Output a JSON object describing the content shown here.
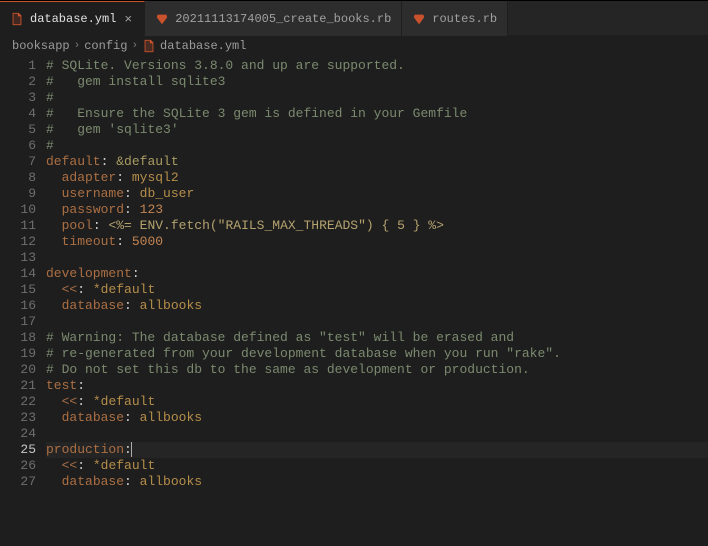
{
  "tabs": [
    {
      "label": "database.yml",
      "icon": "yaml-file-icon",
      "active": true,
      "closable": true
    },
    {
      "label": "20211113174005_create_books.rb",
      "icon": "ruby-file-icon",
      "active": false,
      "closable": false
    },
    {
      "label": "routes.rb",
      "icon": "ruby-file-icon",
      "active": false,
      "closable": false
    }
  ],
  "breadcrumbs": {
    "parts": [
      "booksapp",
      "config"
    ],
    "file": "database.yml"
  },
  "lines": [
    {
      "n": 1,
      "t": "comment",
      "text": "# SQLite. Versions 3.8.0 and up are supported."
    },
    {
      "n": 2,
      "t": "comment",
      "text": "#   gem install sqlite3"
    },
    {
      "n": 3,
      "t": "comment",
      "text": "#"
    },
    {
      "n": 4,
      "t": "comment",
      "text": "#   Ensure the SQLite 3 gem is defined in your Gemfile"
    },
    {
      "n": 5,
      "t": "comment",
      "text": "#   gem 'sqlite3'"
    },
    {
      "n": 6,
      "t": "comment",
      "text": "#"
    },
    {
      "n": 7,
      "t": "kv",
      "indent": 0,
      "key": "default",
      "after": "anchor",
      "val": "&default"
    },
    {
      "n": 8,
      "t": "kv",
      "indent": 1,
      "key": "adapter",
      "after": "str",
      "val": "mysql2"
    },
    {
      "n": 9,
      "t": "kv",
      "indent": 1,
      "key": "username",
      "after": "str",
      "val": "db_user"
    },
    {
      "n": 10,
      "t": "kv",
      "indent": 1,
      "key": "password",
      "after": "num",
      "val": "123"
    },
    {
      "n": 11,
      "t": "kv",
      "indent": 1,
      "key": "pool",
      "after": "erb",
      "val": "<%= ENV.fetch(\"RAILS_MAX_THREADS\") { 5 } %>"
    },
    {
      "n": 12,
      "t": "kv",
      "indent": 1,
      "key": "timeout",
      "after": "num",
      "val": "5000"
    },
    {
      "n": 13,
      "t": "blank"
    },
    {
      "n": 14,
      "t": "kv",
      "indent": 0,
      "key": "development",
      "after": "none"
    },
    {
      "n": 15,
      "t": "kv",
      "indent": 1,
      "key": "<<",
      "after": "alias",
      "val": "*default"
    },
    {
      "n": 16,
      "t": "kv",
      "indent": 1,
      "key": "database",
      "after": "str",
      "val": "allbooks"
    },
    {
      "n": 17,
      "t": "blank"
    },
    {
      "n": 18,
      "t": "comment",
      "text": "# Warning: The database defined as \"test\" will be erased and"
    },
    {
      "n": 19,
      "t": "comment",
      "text": "# re-generated from your development database when you run \"rake\"."
    },
    {
      "n": 20,
      "t": "comment",
      "text": "# Do not set this db to the same as development or production."
    },
    {
      "n": 21,
      "t": "kv",
      "indent": 0,
      "key": "test",
      "after": "none"
    },
    {
      "n": 22,
      "t": "kv",
      "indent": 1,
      "key": "<<",
      "after": "alias",
      "val": "*default"
    },
    {
      "n": 23,
      "t": "kv",
      "indent": 1,
      "key": "database",
      "after": "str",
      "val": "allbooks"
    },
    {
      "n": 24,
      "t": "blank"
    },
    {
      "n": 25,
      "t": "kv",
      "indent": 0,
      "key": "production",
      "after": "none",
      "current": true
    },
    {
      "n": 26,
      "t": "kv",
      "indent": 1,
      "key": "<<",
      "after": "alias",
      "val": "*default"
    },
    {
      "n": 27,
      "t": "kv",
      "indent": 1,
      "key": "database",
      "after": "str",
      "val": "allbooks"
    }
  ]
}
